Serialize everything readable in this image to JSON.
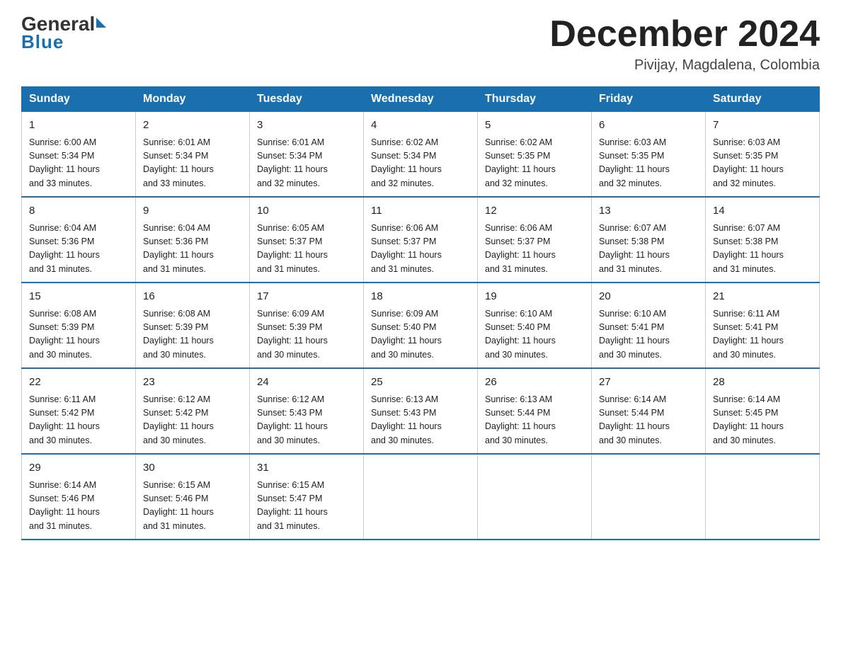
{
  "header": {
    "logo": {
      "general": "General",
      "blue": "Blue",
      "triangle": "▶"
    },
    "title": "December 2024",
    "location": "Pivijay, Magdalena, Colombia"
  },
  "calendar": {
    "days_of_week": [
      "Sunday",
      "Monday",
      "Tuesday",
      "Wednesday",
      "Thursday",
      "Friday",
      "Saturday"
    ],
    "weeks": [
      [
        {
          "day": "1",
          "sunrise": "6:00 AM",
          "sunset": "5:34 PM",
          "daylight": "11 hours and 33 minutes."
        },
        {
          "day": "2",
          "sunrise": "6:01 AM",
          "sunset": "5:34 PM",
          "daylight": "11 hours and 33 minutes."
        },
        {
          "day": "3",
          "sunrise": "6:01 AM",
          "sunset": "5:34 PM",
          "daylight": "11 hours and 32 minutes."
        },
        {
          "day": "4",
          "sunrise": "6:02 AM",
          "sunset": "5:34 PM",
          "daylight": "11 hours and 32 minutes."
        },
        {
          "day": "5",
          "sunrise": "6:02 AM",
          "sunset": "5:35 PM",
          "daylight": "11 hours and 32 minutes."
        },
        {
          "day": "6",
          "sunrise": "6:03 AM",
          "sunset": "5:35 PM",
          "daylight": "11 hours and 32 minutes."
        },
        {
          "day": "7",
          "sunrise": "6:03 AM",
          "sunset": "5:35 PM",
          "daylight": "11 hours and 32 minutes."
        }
      ],
      [
        {
          "day": "8",
          "sunrise": "6:04 AM",
          "sunset": "5:36 PM",
          "daylight": "11 hours and 31 minutes."
        },
        {
          "day": "9",
          "sunrise": "6:04 AM",
          "sunset": "5:36 PM",
          "daylight": "11 hours and 31 minutes."
        },
        {
          "day": "10",
          "sunrise": "6:05 AM",
          "sunset": "5:37 PM",
          "daylight": "11 hours and 31 minutes."
        },
        {
          "day": "11",
          "sunrise": "6:06 AM",
          "sunset": "5:37 PM",
          "daylight": "11 hours and 31 minutes."
        },
        {
          "day": "12",
          "sunrise": "6:06 AM",
          "sunset": "5:37 PM",
          "daylight": "11 hours and 31 minutes."
        },
        {
          "day": "13",
          "sunrise": "6:07 AM",
          "sunset": "5:38 PM",
          "daylight": "11 hours and 31 minutes."
        },
        {
          "day": "14",
          "sunrise": "6:07 AM",
          "sunset": "5:38 PM",
          "daylight": "11 hours and 31 minutes."
        }
      ],
      [
        {
          "day": "15",
          "sunrise": "6:08 AM",
          "sunset": "5:39 PM",
          "daylight": "11 hours and 30 minutes."
        },
        {
          "day": "16",
          "sunrise": "6:08 AM",
          "sunset": "5:39 PM",
          "daylight": "11 hours and 30 minutes."
        },
        {
          "day": "17",
          "sunrise": "6:09 AM",
          "sunset": "5:39 PM",
          "daylight": "11 hours and 30 minutes."
        },
        {
          "day": "18",
          "sunrise": "6:09 AM",
          "sunset": "5:40 PM",
          "daylight": "11 hours and 30 minutes."
        },
        {
          "day": "19",
          "sunrise": "6:10 AM",
          "sunset": "5:40 PM",
          "daylight": "11 hours and 30 minutes."
        },
        {
          "day": "20",
          "sunrise": "6:10 AM",
          "sunset": "5:41 PM",
          "daylight": "11 hours and 30 minutes."
        },
        {
          "day": "21",
          "sunrise": "6:11 AM",
          "sunset": "5:41 PM",
          "daylight": "11 hours and 30 minutes."
        }
      ],
      [
        {
          "day": "22",
          "sunrise": "6:11 AM",
          "sunset": "5:42 PM",
          "daylight": "11 hours and 30 minutes."
        },
        {
          "day": "23",
          "sunrise": "6:12 AM",
          "sunset": "5:42 PM",
          "daylight": "11 hours and 30 minutes."
        },
        {
          "day": "24",
          "sunrise": "6:12 AM",
          "sunset": "5:43 PM",
          "daylight": "11 hours and 30 minutes."
        },
        {
          "day": "25",
          "sunrise": "6:13 AM",
          "sunset": "5:43 PM",
          "daylight": "11 hours and 30 minutes."
        },
        {
          "day": "26",
          "sunrise": "6:13 AM",
          "sunset": "5:44 PM",
          "daylight": "11 hours and 30 minutes."
        },
        {
          "day": "27",
          "sunrise": "6:14 AM",
          "sunset": "5:44 PM",
          "daylight": "11 hours and 30 minutes."
        },
        {
          "day": "28",
          "sunrise": "6:14 AM",
          "sunset": "5:45 PM",
          "daylight": "11 hours and 30 minutes."
        }
      ],
      [
        {
          "day": "29",
          "sunrise": "6:14 AM",
          "sunset": "5:46 PM",
          "daylight": "11 hours and 31 minutes."
        },
        {
          "day": "30",
          "sunrise": "6:15 AM",
          "sunset": "5:46 PM",
          "daylight": "11 hours and 31 minutes."
        },
        {
          "day": "31",
          "sunrise": "6:15 AM",
          "sunset": "5:47 PM",
          "daylight": "11 hours and 31 minutes."
        },
        null,
        null,
        null,
        null
      ]
    ],
    "sunrise_label": "Sunrise:",
    "sunset_label": "Sunset:",
    "daylight_label": "Daylight:"
  }
}
